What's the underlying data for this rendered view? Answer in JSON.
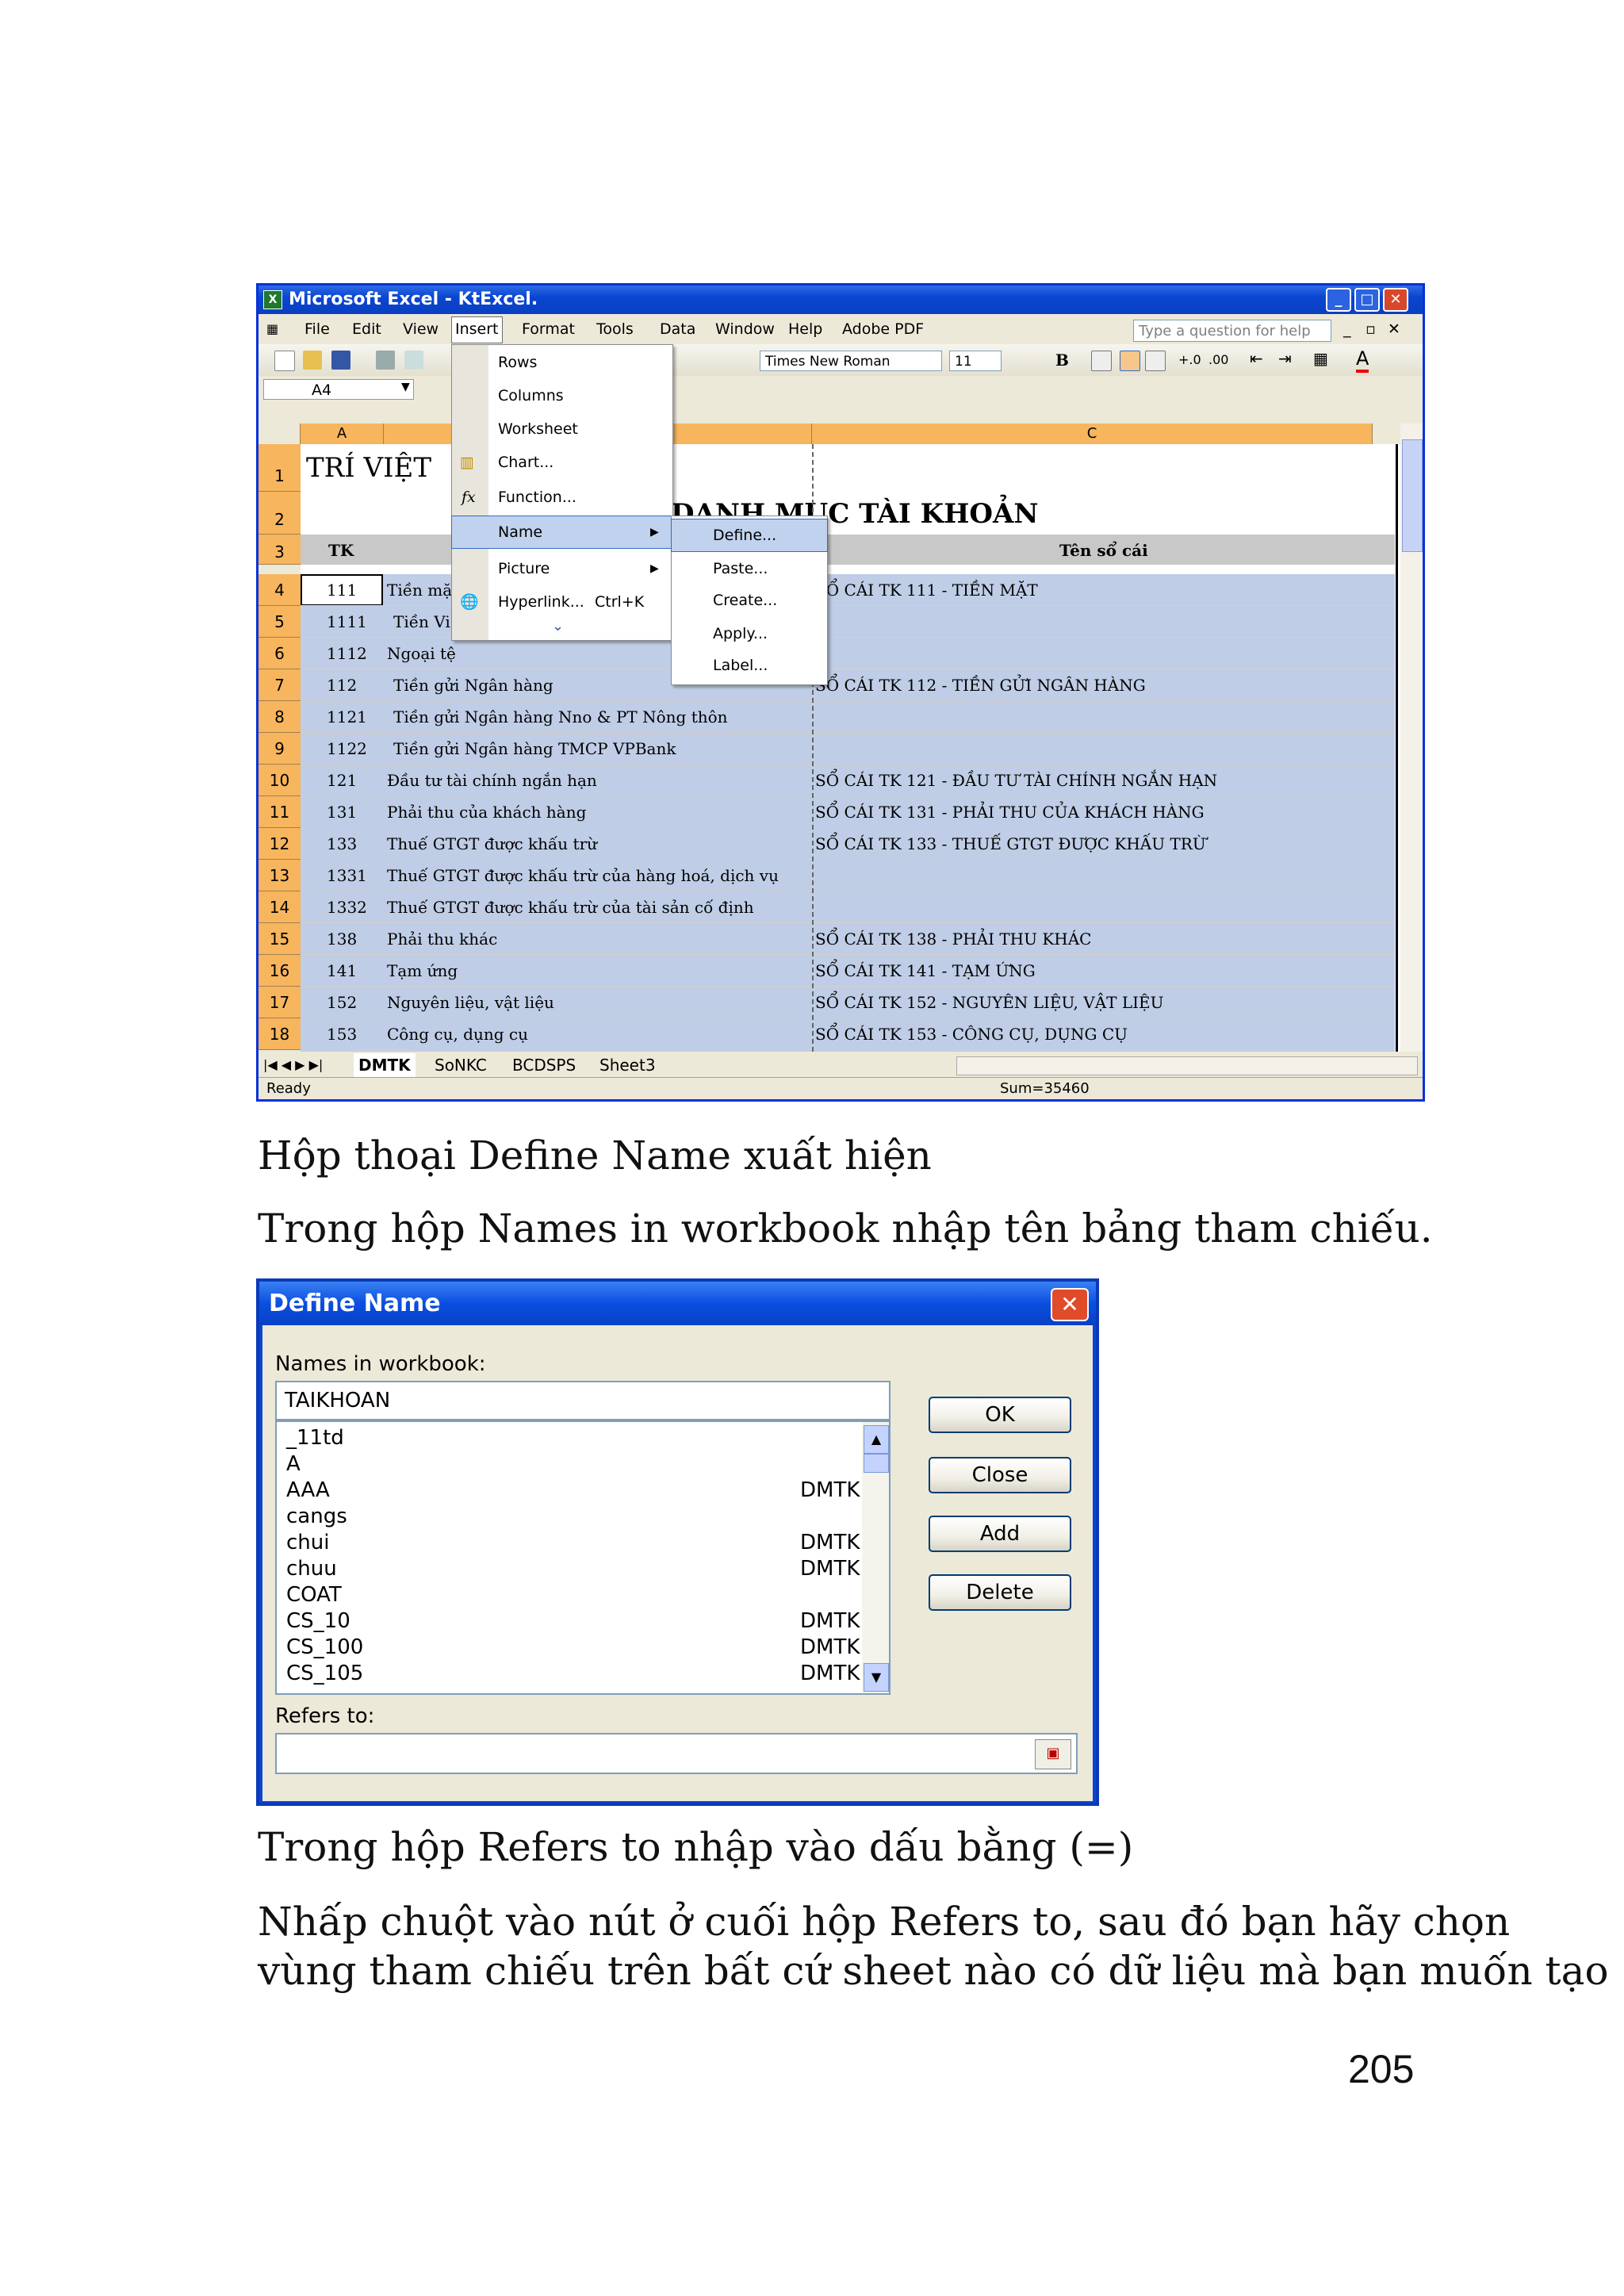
{
  "excel": {
    "title": "Microsoft Excel - KtExcel.",
    "menus": [
      "File",
      "Edit",
      "View",
      "Insert",
      "Format",
      "Tools",
      "Data",
      "Window",
      "Help",
      "Adobe PDF"
    ],
    "help_placeholder": "Type a question for help",
    "font": "Times New Roman",
    "font_size": "11",
    "name_box": "A4",
    "columns": [
      "A",
      "C"
    ],
    "company": "TRÍ VIỆT",
    "heading": "DANH MỤC TÀI KHOẢN",
    "col_tk": "TK",
    "col_ten": "Tên sổ cái",
    "rows": [
      {
        "n": "4",
        "tk": "111",
        "name": "Tiền mặt",
        "ledger": "SỔ CÁI TK 111 - TIỀN MẶT"
      },
      {
        "n": "5",
        "tk": "1111",
        "name": "Tiền Vi",
        "ledger": ""
      },
      {
        "n": "6",
        "tk": "1112",
        "name": "Ngoại tệ",
        "ledger": ""
      },
      {
        "n": "7",
        "tk": "112",
        "name": "Tiền gửi Ngân hàng",
        "ledger": "SỔ CÁI TK 112 - TIỀN GỬI NGÂN HÀNG"
      },
      {
        "n": "8",
        "tk": "1121",
        "name": "Tiền gửi Ngân hàng Nno & PT Nông thôn",
        "ledger": ""
      },
      {
        "n": "9",
        "tk": "1122",
        "name": "Tiền gửi Ngân hàng TMCP VPBank",
        "ledger": ""
      },
      {
        "n": "10",
        "tk": "121",
        "name": "Đầu tư tài chính ngắn hạn",
        "ledger": "SỔ CÁI TK 121 - ĐẦU TƯ TÀI CHÍNH NGẮN HẠN"
      },
      {
        "n": "11",
        "tk": "131",
        "name": "Phải thu của khách hàng",
        "ledger": "SỔ CÁI TK 131 - PHẢI THU CỦA KHÁCH HÀNG"
      },
      {
        "n": "12",
        "tk": "133",
        "name": "Thuế GTGT được khấu trừ",
        "ledger": "SỔ CÁI TK 133 - THUẾ GTGT ĐƯỢC KHẤU TRỪ"
      },
      {
        "n": "13",
        "tk": "1331",
        "name": "Thuế GTGT được khấu trừ của hàng hoá, dịch vụ",
        "ledger": ""
      },
      {
        "n": "14",
        "tk": "1332",
        "name": "Thuế GTGT được khấu trừ của tài sản cố định",
        "ledger": ""
      },
      {
        "n": "15",
        "tk": "138",
        "name": "Phải thu khác",
        "ledger": "SỔ CÁI TK 138 - PHẢI THU KHÁC"
      },
      {
        "n": "16",
        "tk": "141",
        "name": "Tạm ứng",
        "ledger": "SỔ CÁI TK 141 - TẠM ỨNG"
      },
      {
        "n": "17",
        "tk": "152",
        "name": "Nguyên liệu, vật liệu",
        "ledger": "SỔ CÁI TK 152 - NGUYÊN LIỆU, VẬT LIỆU"
      },
      {
        "n": "18",
        "tk": "153",
        "name": "Công cụ, dụng cụ",
        "ledger": "SỔ CÁI TK 153 - CÔNG CỤ, DỤNG CỤ"
      }
    ],
    "insert_menu": [
      "Rows",
      "Columns",
      "Worksheet",
      "Chart...",
      "Function...",
      "Name",
      "Picture",
      "Hyperlink..."
    ],
    "hyperlink_shortcut": "Ctrl+K",
    "name_submenu": [
      "Define...",
      "Paste...",
      "Create...",
      "Apply...",
      "Label..."
    ],
    "sheet_tabs": [
      "DMTK",
      "SoNKC",
      "BCDSPS",
      "Sheet3"
    ],
    "status_left": "Ready",
    "status_sum": "Sum=35460"
  },
  "text": {
    "p1": "Hộp thoại Define Name xuất hiện",
    "p2": "Trong hộp Names in workbook nhập tên bảng tham chiếu.",
    "p3": "Trong hộp Refers to nhập vào dấu bằng (=)",
    "p4_line1": "Nhấp chuột vào nút ở cuối hộp Refers to, sau đó bạn hãy chọn",
    "p4_line2": "vùng tham chiếu trên bất cứ sheet nào có dữ liệu mà bạn muốn tạo",
    "page_number": "205"
  },
  "dialog": {
    "title": "Define Name",
    "names_label": "Names in workbook:",
    "name_value": "TAIKHOAN",
    "list": [
      {
        "name": "_11td",
        "sheet": ""
      },
      {
        "name": "A",
        "sheet": ""
      },
      {
        "name": "AAA",
        "sheet": "DMTK"
      },
      {
        "name": "cangs",
        "sheet": ""
      },
      {
        "name": "chui",
        "sheet": "DMTK"
      },
      {
        "name": "chuu",
        "sheet": "DMTK"
      },
      {
        "name": "COAT",
        "sheet": ""
      },
      {
        "name": "CS_10",
        "sheet": "DMTK"
      },
      {
        "name": "CS_100",
        "sheet": "DMTK"
      },
      {
        "name": "CS_105",
        "sheet": "DMTK"
      }
    ],
    "refers_label": "Refers to:",
    "refers_value": "",
    "buttons": {
      "ok": "OK",
      "close": "Close",
      "add": "Add",
      "delete": "Delete"
    }
  }
}
